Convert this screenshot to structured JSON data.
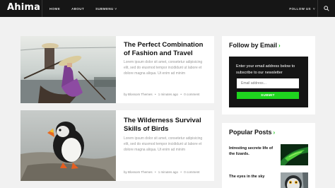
{
  "site": {
    "logo": "Ahima"
  },
  "nav": {
    "items": [
      {
        "label": "HOME"
      },
      {
        "label": "ABOUT"
      },
      {
        "label": "SUBMENU",
        "caret": "˅"
      }
    ],
    "follow_label": "FOLLOW US",
    "follow_caret": "˅",
    "search_icon": "search-icon"
  },
  "posts": [
    {
      "title": "The Perfect Combination of Fashion and Travel",
      "excerpt": "Lorem ipsum dolor sit amet, consetetur adipisicing elit, sed do eiusmod tempor incididunt ut labore et dolore magna aliqua. Ut enim ad minim",
      "author": "by Blossom Themes",
      "time": "1 minutes ago",
      "comments": "0 comment",
      "separator": "•"
    },
    {
      "title": "The Wilderness Survival Skills of Birds",
      "excerpt": "Lorem ipsum dolor sit amet, consetetur adipisicing elit, sed do eiusmod tempor incididunt ut labore et dolore magna aliqua. Ut enim ad minim",
      "author": "by Blossom Themes",
      "time": "1 minutes ago",
      "comments": "0 comment",
      "separator": "•"
    }
  ],
  "follow_widget": {
    "title": "Follow by Email",
    "arrow": "›",
    "text": "Enter your email address below to subscribe to our newsletter",
    "placeholder": "Email address...",
    "button": "SUBMIT"
  },
  "popular_widget": {
    "title": "Popular Posts",
    "arrow": "›",
    "items": [
      {
        "title": "Intresting secrete life of the lizards."
      },
      {
        "title": "The eyes in the sky"
      }
    ]
  },
  "colors": {
    "accent": "#1fd41f",
    "topbar": "#161616",
    "background": "#f1f1f1"
  }
}
